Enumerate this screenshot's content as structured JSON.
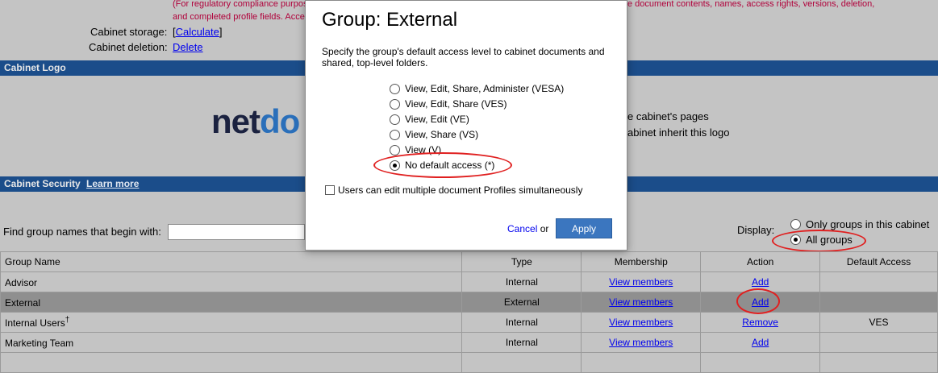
{
  "top": {
    "note_line1": "(For regulatory compliance purpos",
    "note_line1_right": "e document contents, names, access rights, versions, deletion,",
    "note_line2": "and completed profile fields. Accep",
    "storage_label": "Cabinet storage:",
    "storage_bracket_open": "[",
    "storage_link": "Calculate",
    "storage_bracket_close": "]",
    "deletion_label": "Cabinet deletion:",
    "deletion_link": "Delete"
  },
  "logo_section": {
    "title": "Cabinet Logo",
    "logo_main": "net",
    "logo_accent": "do",
    "text1": "e cabinet's pages",
    "text2": "abinet inherit this logo"
  },
  "security_section": {
    "title": "Cabinet Security",
    "learn_more": "Learn more",
    "find_label": "Find group names that begin with:",
    "find_value": "",
    "display_label": "Display:",
    "display_options": [
      {
        "label": "Only groups in this cabinet",
        "selected": false
      },
      {
        "label": "All groups",
        "selected": true
      }
    ]
  },
  "table": {
    "headers": [
      "Group Name",
      "Type",
      "Membership",
      "Action",
      "Default Access"
    ],
    "rows": [
      {
        "name": "Advisor",
        "sup": "",
        "type": "Internal",
        "membership": "View members",
        "action": "Add",
        "access": ""
      },
      {
        "name": "External",
        "sup": "",
        "type": "External",
        "membership": "View members",
        "action": "Add",
        "access": ""
      },
      {
        "name": "Internal Users",
        "sup": "†",
        "type": "Internal",
        "membership": "View members",
        "action": "Remove",
        "access": "VES"
      },
      {
        "name": "Marketing Team",
        "sup": "",
        "type": "Internal",
        "membership": "View members",
        "action": "Add",
        "access": ""
      }
    ]
  },
  "dialog": {
    "title": "Group: External",
    "description": "Specify the group's default access level to cabinet documents and shared, top-level folders.",
    "options": [
      {
        "label": "View, Edit, Share, Administer (VESA)",
        "selected": false
      },
      {
        "label": "View, Edit, Share (VES)",
        "selected": false
      },
      {
        "label": "View, Edit (VE)",
        "selected": false
      },
      {
        "label": "View, Share (VS)",
        "selected": false
      },
      {
        "label": "View (V)",
        "selected": false
      },
      {
        "label": "No default access (*)",
        "selected": true
      }
    ],
    "checkbox_label": "Users can edit multiple document Profiles simultaneously",
    "checkbox_checked": false,
    "cancel": "Cancel",
    "or": "or",
    "apply": "Apply"
  },
  "colors": {
    "section_bar": "#1b4d8a",
    "annotation": "#e02020",
    "apply_button": "#3b76bf",
    "note_text": "#b0003a"
  }
}
